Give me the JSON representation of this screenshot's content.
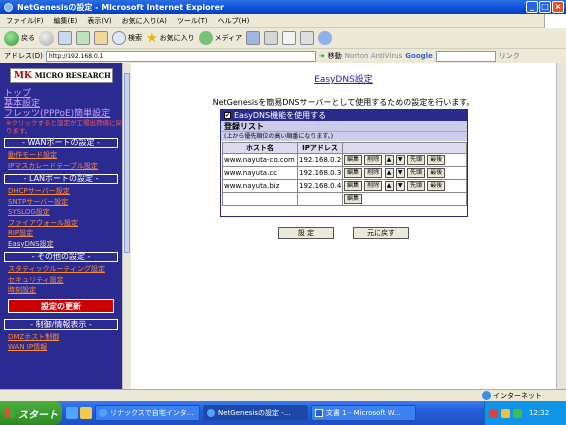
{
  "window": {
    "title": "NetGenesisの設定 - Microsoft Internet Explorer",
    "buttons": [
      "_",
      "□",
      "×"
    ]
  },
  "menu": [
    "ファイル(F)",
    "編集(E)",
    "表示(V)",
    "お気に入り(A)",
    "ツール(T)",
    "ヘルプ(H)"
  ],
  "toolbar": {
    "back_label": "戻る",
    "search_label": "検索",
    "favorites_label": "お気に入り",
    "media_label": "メディア"
  },
  "address": {
    "label": "アドレス(D)",
    "url": "http://192.168.0.1",
    "go_label": "移動",
    "norton_label": "Norton AntiVirus",
    "google_label": "Google",
    "links_label": "リンク"
  },
  "sidebar": {
    "logo_text": "MICRO RESEARCH",
    "top_links": [
      "トップ",
      "基本設定",
      "フレッツ(PPPoE)簡単設定"
    ],
    "note": "※クリックすると設定が工場出荷値に戻ります。",
    "wan_header": "- WANポートの設定 -",
    "wan_links": [
      "動作モード設定",
      "IPマスカレードテーブル設定"
    ],
    "lan_header": "- LANポートの設定 -",
    "lan_links": [
      "DHCPサーバー設定",
      "SNTPサーバー設定",
      "SYSLOG設定",
      "ファイアウォール設定",
      "RIP設定",
      "EasyDNS設定"
    ],
    "other_header": "- その他の設定 -",
    "other_links": [
      "スタティックルーティング設定",
      "セキュリティ設定",
      "時刻設定"
    ],
    "update_label": "設定の更新",
    "control_header": "- 制御/情報表示 -",
    "control_links": [
      "DMZホスト制御",
      "WAN IP情報"
    ]
  },
  "main": {
    "title": "EasyDNS設定",
    "description": "NetGenesisを簡易DNSサーバーとして使用するための設定を行います。",
    "enable_label": "EasyDNS機能を使用する",
    "enable_checked": true,
    "list_title": "登録リスト",
    "list_note": "(上から優先順位の高い順番になります。)",
    "columns": [
      "ホスト名",
      "IPアドレス"
    ],
    "rows": [
      {
        "host": "www.nayuta-co.com",
        "ip": "192.168.0.2"
      },
      {
        "host": "www.nayuta.cc",
        "ip": "192.168.0.3"
      },
      {
        "host": "www.nayuta.biz",
        "ip": "192.168.0.4"
      }
    ],
    "row_buttons": {
      "edit": "編集",
      "delete": "削除",
      "up": "▲",
      "down": "▼",
      "first": "先頭",
      "last": "最後"
    },
    "empty_row_edit": "編集",
    "submit_label": "設 定",
    "reset_label": "元に戻す"
  },
  "statusbar": {
    "zone": "インターネット"
  },
  "taskbar": {
    "start_label": "スタート",
    "tasks": [
      "リナックスで自宅インタ...",
      "NetGenesisの設定 -...",
      "文書 1 - Microsoft W..."
    ],
    "clock": "12:32"
  }
}
